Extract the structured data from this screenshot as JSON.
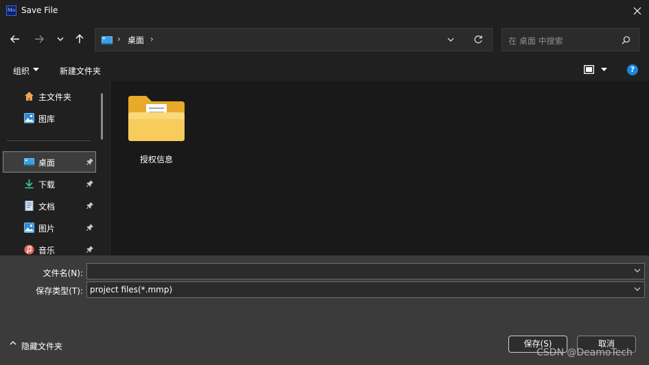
{
  "window": {
    "title": "Save File",
    "app_logo_text": "Mo"
  },
  "address": {
    "crumb": "桌面",
    "separator": "›"
  },
  "search": {
    "placeholder": "在 桌面 中搜索"
  },
  "toolbar": {
    "organize_label": "组织",
    "new_folder_label": "新建文件夹",
    "help_label": "?"
  },
  "nav_pane": {
    "items": [
      {
        "label": "主文件夹",
        "icon": "home-icon",
        "pinned": false
      },
      {
        "label": "图库",
        "icon": "gallery-icon",
        "pinned": false
      },
      {
        "label": "桌面",
        "icon": "desktop-icon",
        "pinned": true,
        "selected": true
      },
      {
        "label": "下载",
        "icon": "download-icon",
        "pinned": true
      },
      {
        "label": "文档",
        "icon": "document-icon",
        "pinned": true
      },
      {
        "label": "图片",
        "icon": "pictures-icon",
        "pinned": true
      },
      {
        "label": "音乐",
        "icon": "music-icon",
        "pinned": true
      }
    ]
  },
  "content": {
    "items": [
      {
        "name": "授权信息",
        "type": "folder"
      }
    ]
  },
  "form": {
    "filename_label": "文件名(N):",
    "filename_value": "",
    "filetype_label": "保存类型(T):",
    "filetype_value": "project files(*.mmp)"
  },
  "footer": {
    "hide_folders_label": "隐藏文件夹",
    "save_label": "保存(S)",
    "cancel_label": "取消",
    "watermark": "CSDN @DeamoTech"
  },
  "colors": {
    "accent": "#1a86e0",
    "folder": "#f2c243",
    "background": "#202020"
  }
}
